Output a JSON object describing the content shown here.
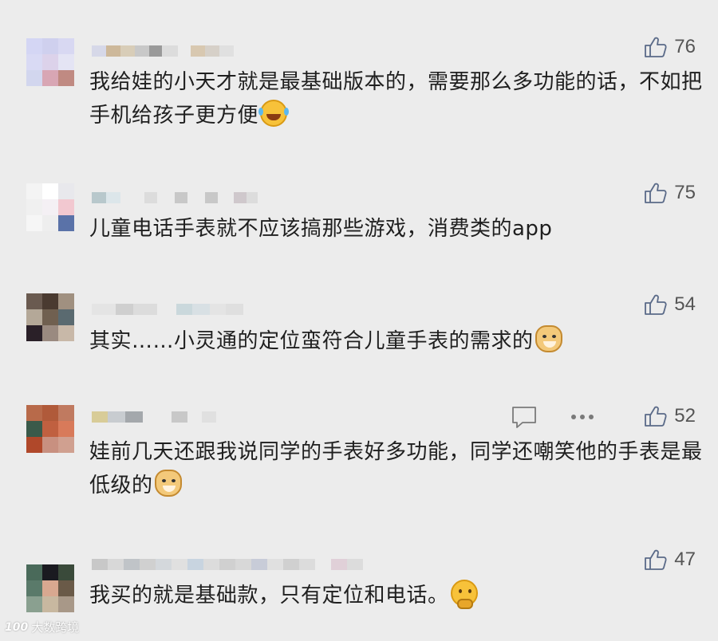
{
  "comments": [
    {
      "text": "我给娃的小天才就是最基础版本的，需要那么多功能的话，不如把手机给孩子更方便",
      "emoji": "laughing-with-tears-icon",
      "likes": "76"
    },
    {
      "text": "儿童电话手表就不应该搞那些游戏，消费类的app",
      "emoji": "",
      "likes": "75"
    },
    {
      "text": "其实……小灵通的定位蛮符合儿童手表的需求的",
      "emoji": "doge-icon",
      "likes": "54"
    },
    {
      "text": "娃前几天还跟我说同学的手表好多功能，同学还嘲笑他的手表是最低级的",
      "emoji": "doge-icon",
      "likes": "52"
    },
    {
      "text": "我买的就是基础款，只有定位和电话。",
      "emoji": "thinking-icon",
      "likes": "47"
    }
  ],
  "watermark": {
    "text": "大数跨境",
    "logo": "100"
  },
  "colors": {
    "background": "#ececec",
    "text": "#1f1f1f",
    "meta": "#555555"
  }
}
